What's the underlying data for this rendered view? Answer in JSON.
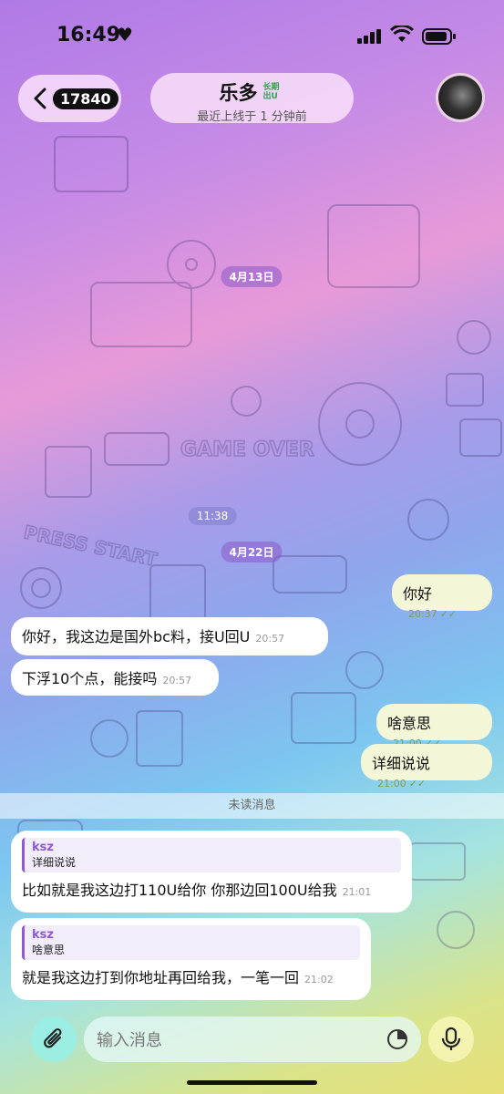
{
  "status_bar": {
    "time": "16:49"
  },
  "header": {
    "back_count": "17840",
    "title": "乐多",
    "badge": "长期 出U",
    "subtitle": "最近上线于 1 分钟前"
  },
  "wallpaper": {
    "game_text": "GAME OVER",
    "press_text": "PRESS START"
  },
  "chat": {
    "dates": [
      "4月13日",
      "11:38",
      "4月22日"
    ],
    "messages": [
      {
        "text": "你好",
        "time": "20:37"
      },
      {
        "text": "你好，我这边是国外bc料，接U回U",
        "time": "20:57"
      },
      {
        "text": "下浮10个点，能接吗",
        "time": "20:57"
      },
      {
        "text": "啥意思",
        "time": "21:00"
      },
      {
        "text": "详细说说",
        "time": "21:00"
      }
    ],
    "unread_label": "未读消息",
    "replies": [
      {
        "quote_author": "ksz",
        "quote_text": "详细说说",
        "text": "比如就是我这边打110U给你  你那边回100U给我",
        "time": "21:01"
      },
      {
        "quote_author": "ksz",
        "quote_text": "啥意思",
        "text": "就是我这边打到你地址再回给我，一笔一回",
        "time": "21:02"
      }
    ]
  },
  "input": {
    "placeholder": "输入消息"
  }
}
